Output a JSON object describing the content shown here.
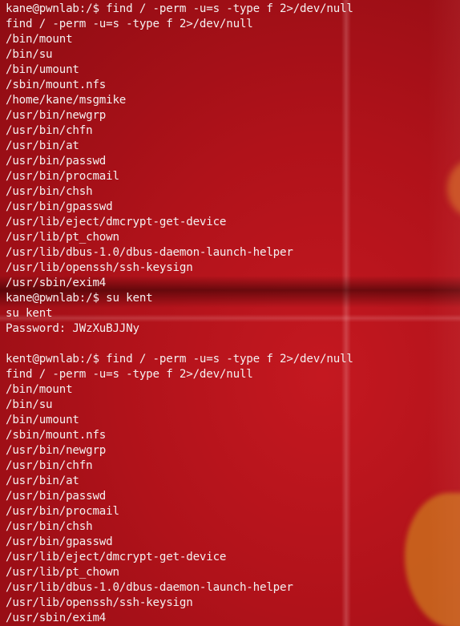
{
  "terminal": {
    "lines": [
      "kane@pwnlab:/$ find / -perm -u=s -type f 2>/dev/null",
      "find / -perm -u=s -type f 2>/dev/null",
      "/bin/mount",
      "/bin/su",
      "/bin/umount",
      "/sbin/mount.nfs",
      "/home/kane/msgmike",
      "/usr/bin/newgrp",
      "/usr/bin/chfn",
      "/usr/bin/at",
      "/usr/bin/passwd",
      "/usr/bin/procmail",
      "/usr/bin/chsh",
      "/usr/bin/gpasswd",
      "/usr/lib/eject/dmcrypt-get-device",
      "/usr/lib/pt_chown",
      "/usr/lib/dbus-1.0/dbus-daemon-launch-helper",
      "/usr/lib/openssh/ssh-keysign",
      "/usr/sbin/exim4",
      "kane@pwnlab:/$ su kent",
      "su kent",
      "Password: JWzXuBJJNy",
      "",
      "kent@pwnlab:/$ find / -perm -u=s -type f 2>/dev/null",
      "find / -perm -u=s -type f 2>/dev/null",
      "/bin/mount",
      "/bin/su",
      "/bin/umount",
      "/sbin/mount.nfs",
      "/usr/bin/newgrp",
      "/usr/bin/chfn",
      "/usr/bin/at",
      "/usr/bin/passwd",
      "/usr/bin/procmail",
      "/usr/bin/chsh",
      "/usr/bin/gpasswd",
      "/usr/lib/eject/dmcrypt-get-device",
      "/usr/lib/pt_chown",
      "/usr/lib/dbus-1.0/dbus-daemon-launch-helper",
      "/usr/lib/openssh/ssh-keysign",
      "/usr/sbin/exim4"
    ]
  }
}
